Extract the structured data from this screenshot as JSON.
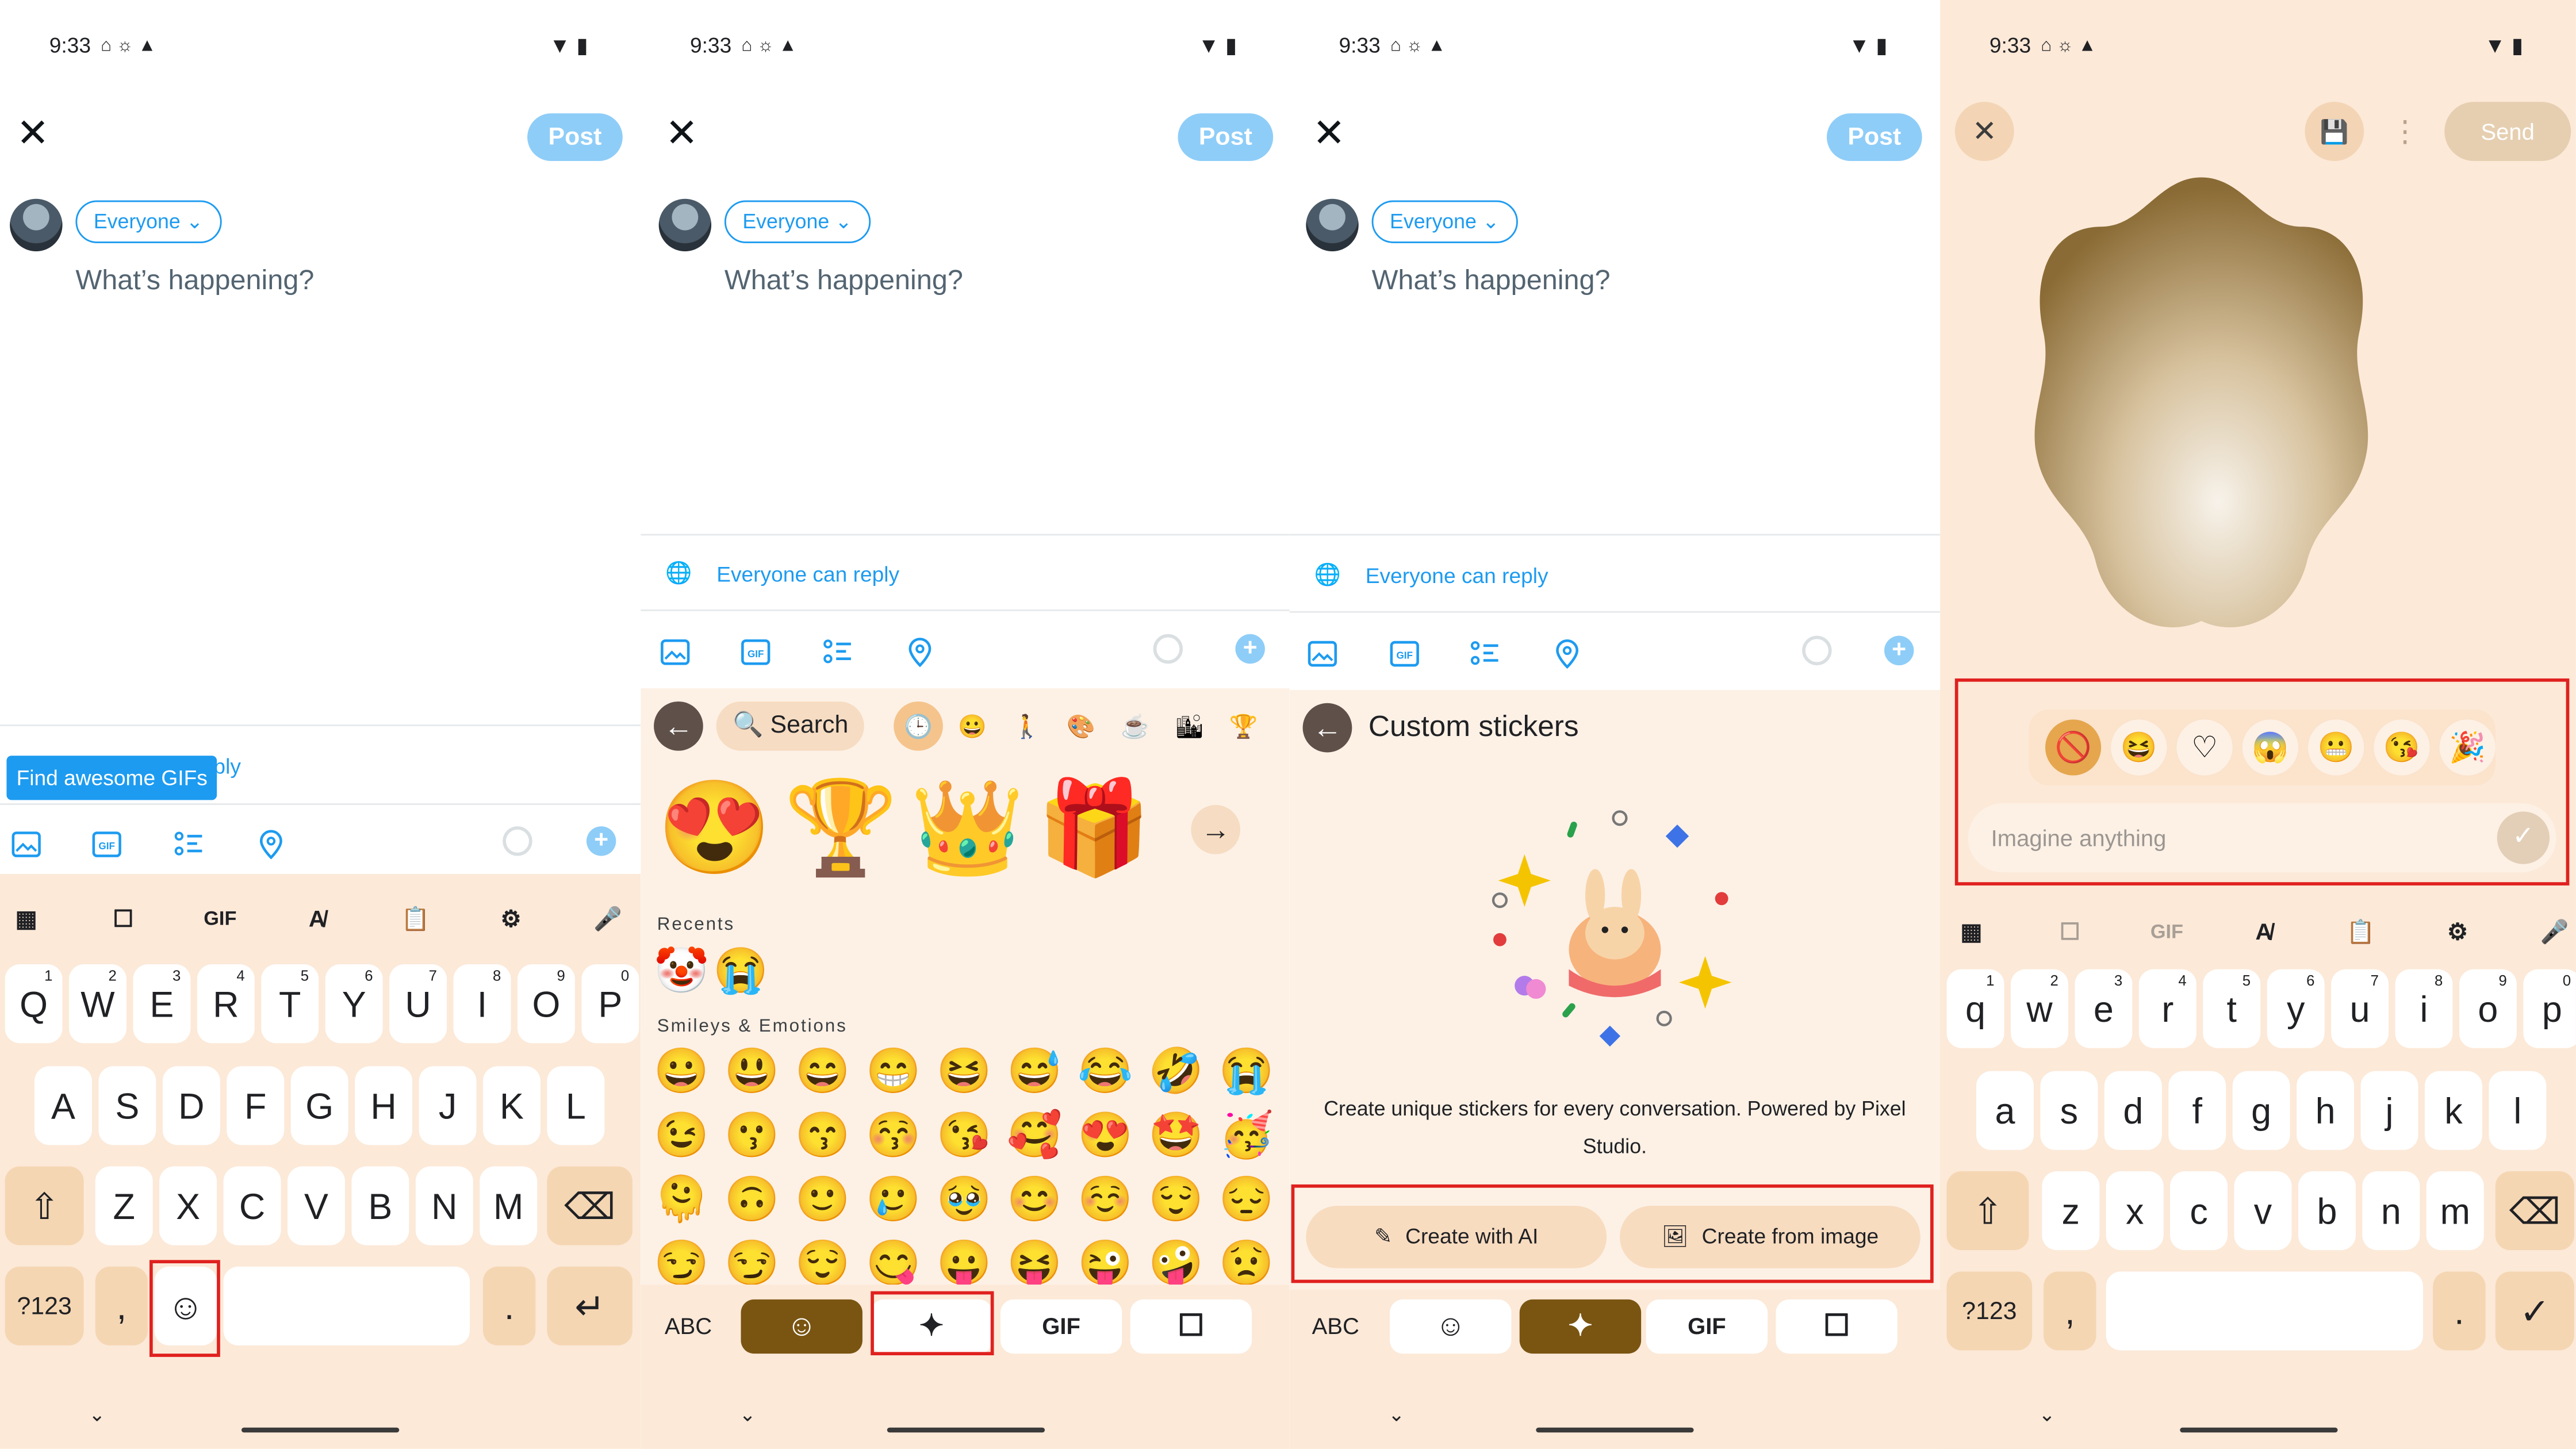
{
  "status": {
    "time": "9:33",
    "left_icons": "⌂ ☼ ▲",
    "right_icons": "▼ ▮"
  },
  "compose": {
    "close": "✕",
    "post_label": "Post",
    "audience_label": "Everyone ⌄",
    "placeholder": "What’s happening?",
    "reply_label": "Everyone can reply",
    "reply_partial": "ply"
  },
  "tooltip": {
    "text": "Find awesome GIFs"
  },
  "toolbar_icons": [
    "image-icon",
    "gif-icon",
    "poll-icon",
    "location-icon"
  ],
  "keyboard": {
    "top_icons": [
      "apps-icon",
      "sticker-icon",
      "gif-icon",
      "handwriting-icon",
      "clipboard-icon",
      "settings-icon",
      "mic-icon"
    ],
    "gif_label": "GIF",
    "row1": [
      {
        "k": "Q",
        "n": "1"
      },
      {
        "k": "W",
        "n": "2"
      },
      {
        "k": "E",
        "n": "3"
      },
      {
        "k": "R",
        "n": "4"
      },
      {
        "k": "T",
        "n": "5"
      },
      {
        "k": "Y",
        "n": "6"
      },
      {
        "k": "U",
        "n": "7"
      },
      {
        "k": "I",
        "n": "8"
      },
      {
        "k": "O",
        "n": "9"
      },
      {
        "k": "P",
        "n": "0"
      }
    ],
    "row2": [
      "A",
      "S",
      "D",
      "F",
      "G",
      "H",
      "J",
      "K",
      "L"
    ],
    "row3": [
      "Z",
      "X",
      "C",
      "V",
      "B",
      "N",
      "M"
    ],
    "row1_lower": [
      {
        "k": "q",
        "n": "1"
      },
      {
        "k": "w",
        "n": "2"
      },
      {
        "k": "e",
        "n": "3"
      },
      {
        "k": "r",
        "n": "4"
      },
      {
        "k": "t",
        "n": "5"
      },
      {
        "k": "y",
        "n": "6"
      },
      {
        "k": "u",
        "n": "7"
      },
      {
        "k": "i",
        "n": "8"
      },
      {
        "k": "o",
        "n": "9"
      },
      {
        "k": "p",
        "n": "0"
      }
    ],
    "row2_lower": [
      "a",
      "s",
      "d",
      "f",
      "g",
      "h",
      "j",
      "k",
      "l"
    ],
    "row3_lower": [
      "z",
      "x",
      "c",
      "v",
      "b",
      "n",
      "m"
    ],
    "sym_label": "?123",
    "comma": ",",
    "period": ".",
    "shift": "⇧",
    "backspace": "⌫",
    "enter": "↵",
    "check": "✓",
    "emoji_key": "☺"
  },
  "emoji_panel": {
    "search_placeholder": "Search",
    "back": "←",
    "category_icons": [
      "🕒",
      "😀",
      "🚶",
      "🎨",
      "☕",
      "🏙",
      "🏆"
    ],
    "suggested": [
      "😍",
      "🏆",
      "👑",
      "🎁"
    ],
    "next": "→",
    "recents_label": "Recents",
    "recents": [
      "🤡",
      "😭"
    ],
    "smileys_label": "Smileys & Emotions",
    "smileys": [
      "😀",
      "😃",
      "😄",
      "😁",
      "😆",
      "😅",
      "😂",
      "🤣",
      "😭",
      "😉",
      "😗",
      "😙",
      "😚",
      "😘",
      "🥰",
      "😍",
      "🤩",
      "🥳",
      "🫠",
      "🙃",
      "🙂",
      "🥲",
      "🥹",
      "😊",
      "☺️",
      "😌",
      "😔",
      "😏",
      "😏",
      "😌",
      "😋",
      "😛",
      "😝",
      "😜",
      "🤪",
      "😟"
    ],
    "abc_label": "ABC",
    "bottom_gif_label": "GIF"
  },
  "stickers": {
    "title": "Custom stickers",
    "description": "Create unique stickers for every conversation. Powered by Pixel Studio.",
    "create_ai": "Create with AI",
    "create_image": "Create from image"
  },
  "pixel_studio": {
    "send_label": "Send",
    "close": "✕",
    "imagine_placeholder": "Imagine anything",
    "style_icons": [
      "🚫",
      "😆",
      "♡",
      "😱",
      "😬",
      "😘",
      "🎉"
    ]
  },
  "colors": {
    "accent": "#1d9bf0",
    "keyboard_bg": "#fce9d8",
    "key_bg": "#ffffff",
    "active_tab": "#7a5512",
    "highlight": "#e0211f"
  }
}
